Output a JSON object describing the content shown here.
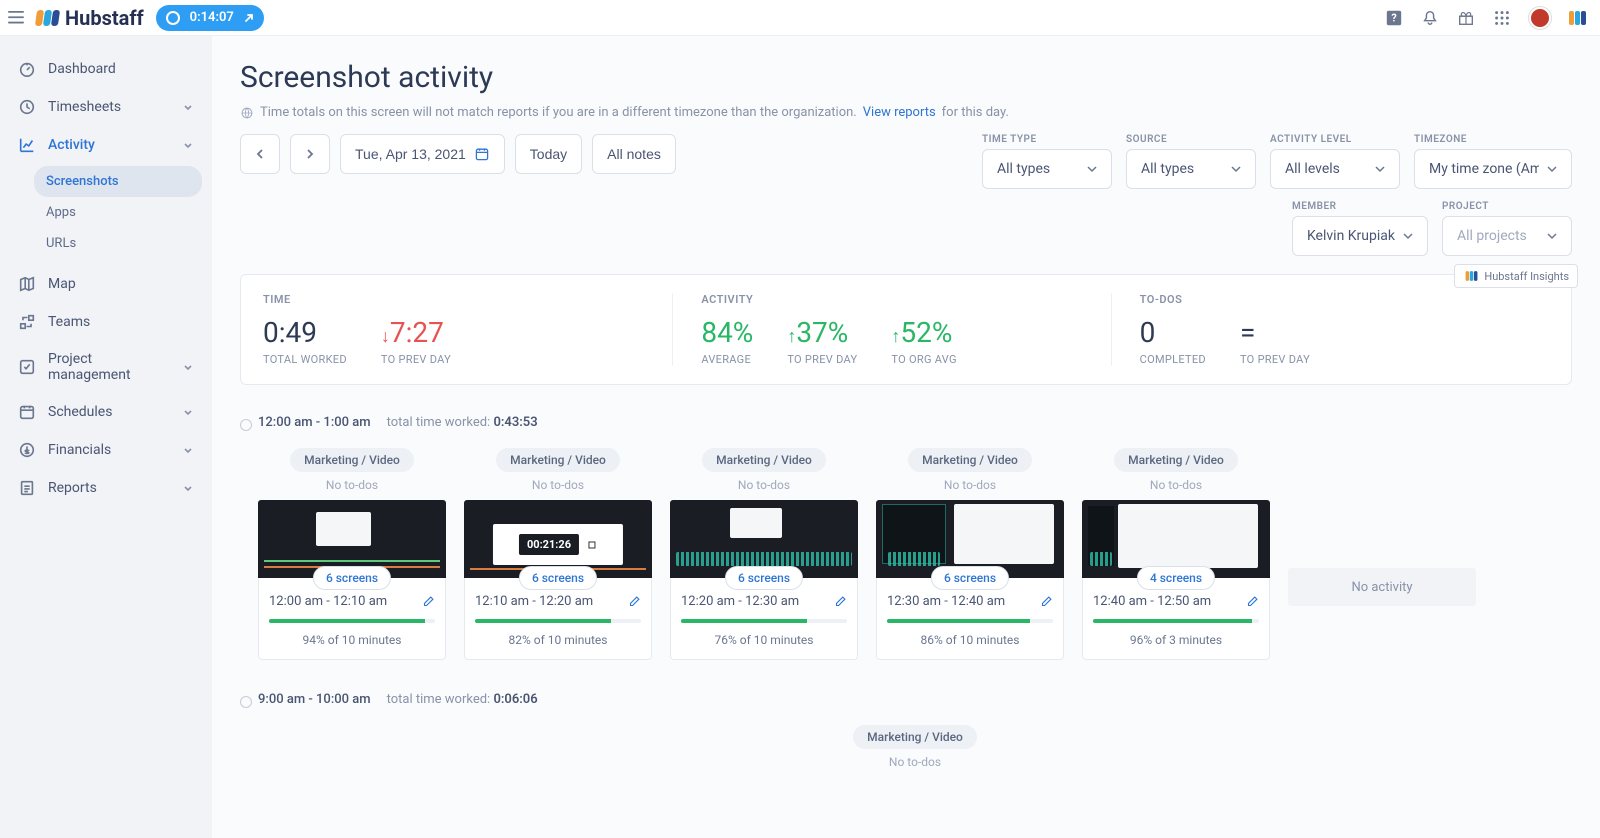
{
  "topbar": {
    "brand": "Hubstaff",
    "timer": "0:14:07"
  },
  "sidebar": {
    "items": [
      {
        "label": "Dashboard",
        "icon": "gauge"
      },
      {
        "label": "Timesheets",
        "icon": "clock",
        "chev": true
      },
      {
        "label": "Activity",
        "icon": "chart",
        "active": true,
        "chev": true,
        "sub": [
          {
            "label": "Screenshots",
            "active": true
          },
          {
            "label": "Apps"
          },
          {
            "label": "URLs"
          }
        ]
      },
      {
        "label": "Map",
        "icon": "map"
      },
      {
        "label": "Teams",
        "icon": "teams"
      },
      {
        "label": "Project management",
        "icon": "check",
        "chev": true
      },
      {
        "label": "Schedules",
        "icon": "calendar",
        "chev": true
      },
      {
        "label": "Financials",
        "icon": "dollar",
        "chev": true
      },
      {
        "label": "Reports",
        "icon": "report",
        "chev": true
      }
    ]
  },
  "page": {
    "title": "Screenshot activity",
    "notice_pre": "Time totals on this screen will not match reports if you are in a different timezone than the organization.",
    "notice_link": "View reports",
    "notice_post": "for this day."
  },
  "toolbar": {
    "date": "Tue, Apr 13, 2021",
    "today": "Today",
    "all_notes": "All notes",
    "filters": {
      "time_type": {
        "label": "TIME TYPE",
        "value": "All types"
      },
      "source": {
        "label": "SOURCE",
        "value": "All types"
      },
      "activity_level": {
        "label": "ACTIVITY LEVEL",
        "value": "All levels"
      },
      "timezone": {
        "label": "TIMEZONE",
        "value": "My time zone (Ame"
      },
      "member": {
        "label": "MEMBER",
        "value": "Kelvin Krupiak"
      },
      "project": {
        "label": "PROJECT",
        "value": "All projects"
      }
    }
  },
  "insights": "Hubstaff Insights",
  "stats": {
    "time": {
      "head": "TIME",
      "total": {
        "value": "0:49",
        "sub": "TOTAL WORKED"
      },
      "prev": {
        "value": "7:27",
        "arrow": "↓",
        "sub": "TO PREV DAY"
      }
    },
    "activity": {
      "head": "ACTIVITY",
      "avg": {
        "value": "84%",
        "sub": "AVERAGE"
      },
      "prev": {
        "value": "37%",
        "arrow": "↑",
        "sub": "TO PREV DAY"
      },
      "org": {
        "value": "52%",
        "arrow": "↑",
        "sub": "TO ORG AVG"
      }
    },
    "todos": {
      "head": "TO-DOS",
      "completed": {
        "value": "0",
        "sub": "COMPLETED"
      },
      "prev": {
        "value": "=",
        "sub": "TO PREV DAY"
      }
    }
  },
  "blocks": [
    {
      "range": "12:00 am - 1:00 am",
      "worked_label": "total time worked:",
      "worked": "0:43:53",
      "cards": [
        {
          "project": "Marketing / Video",
          "todos": "No to-dos",
          "screens": "6 screens",
          "time": "12:00 am - 12:10 am",
          "pct": 94,
          "pct_label": "94% of 10 minutes",
          "variant": 1
        },
        {
          "project": "Marketing / Video",
          "todos": "No to-dos",
          "screens": "6 screens",
          "time": "12:10 am - 12:20 am",
          "pct": 82,
          "pct_label": "82% of 10 minutes",
          "variant": 2,
          "timecode": "00:21:26"
        },
        {
          "project": "Marketing / Video",
          "todos": "No to-dos",
          "screens": "6 screens",
          "time": "12:20 am - 12:30 am",
          "pct": 76,
          "pct_label": "76% of 10 minutes",
          "variant": 3
        },
        {
          "project": "Marketing / Video",
          "todos": "No to-dos",
          "screens": "6 screens",
          "time": "12:30 am - 12:40 am",
          "pct": 86,
          "pct_label": "86% of 10 minutes",
          "variant": 4
        },
        {
          "project": "Marketing / Video",
          "todos": "No to-dos",
          "screens": "4 screens",
          "time": "12:40 am - 12:50 am",
          "pct": 96,
          "pct_label": "96% of 3 minutes",
          "variant": 5
        }
      ],
      "extra_no_activity": "No activity"
    },
    {
      "range": "9:00 am - 10:00 am",
      "worked_label": "total time worked:",
      "worked": "0:06:06",
      "cards": [
        {
          "project": "Marketing / Video",
          "todos": "No to-dos",
          "partial": true
        }
      ]
    }
  ]
}
